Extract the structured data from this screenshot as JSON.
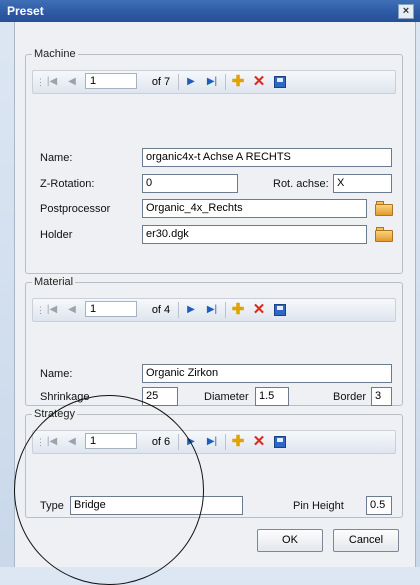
{
  "window": {
    "title": "Preset",
    "close_glyph": "×"
  },
  "machine": {
    "legend": "Machine",
    "nav": {
      "position": "1",
      "of_count": "of 7"
    },
    "fields": {
      "name_label": "Name:",
      "name_value": "organic4x-t Achse A RECHTS",
      "zrot_label": "Z-Rotation:",
      "zrot_value": "0",
      "rotaxis_label": "Rot. achse:",
      "rotaxis_value": "X",
      "post_label": "Postprocessor",
      "post_value": "Organic_4x_Rechts",
      "holder_label": "Holder",
      "holder_value": "er30.dgk"
    }
  },
  "material": {
    "legend": "Material",
    "nav": {
      "position": "1",
      "of_count": "of 4"
    },
    "fields": {
      "name_label": "Name:",
      "name_value": "Organic Zirkon",
      "shrink_label": "Shrinkage",
      "shrink_value": "25",
      "diameter_label": "Diameter",
      "diameter_value": "1.5",
      "border_label": "Border",
      "border_value": "3"
    }
  },
  "strategy": {
    "legend": "Strategy",
    "nav": {
      "position": "1",
      "of_count": "of 6"
    },
    "fields": {
      "type_label": "Type",
      "type_value": "Bridge",
      "pin_label": "Pin Height",
      "pin_value": "0.5"
    }
  },
  "nav_glyphs": {
    "grip": "⋮",
    "first": "|◀",
    "prev": "◀",
    "next": "▶",
    "last": "▶|",
    "add": "✚",
    "delete": "✕"
  },
  "buttons": {
    "ok": "OK",
    "cancel": "Cancel"
  },
  "icons": {
    "add_color": "#e0a300",
    "delete_color": "#d62b1f",
    "save_color": "#2f68c4",
    "folder_color": "#e39a2c"
  }
}
